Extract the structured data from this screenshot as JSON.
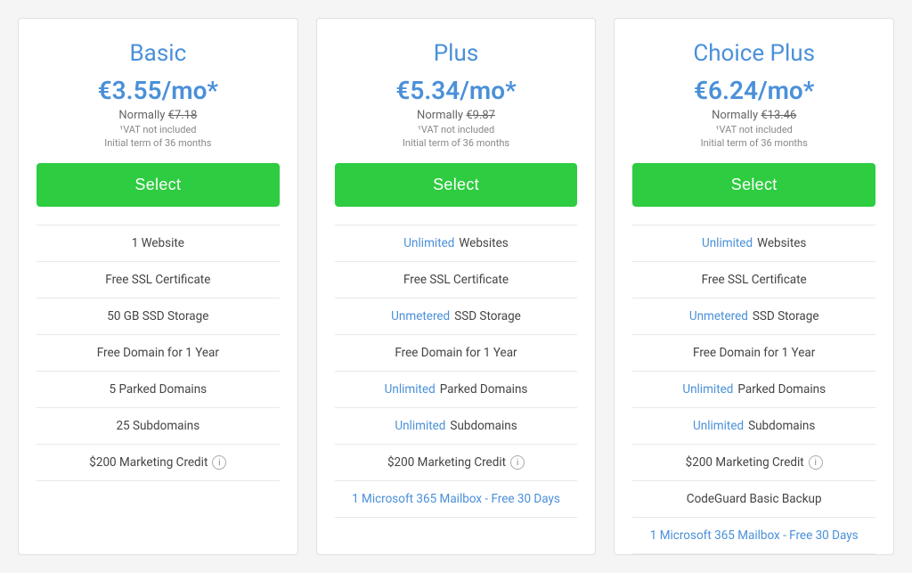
{
  "plans": [
    {
      "id": "basic",
      "title": "Basic",
      "price": "€3.55/mo*",
      "normal_price_label": "Normally",
      "normal_price": "€7.18",
      "vat": "¹VAT not included",
      "term": "Initial term of 36 months",
      "select_label": "Select",
      "features": [
        {
          "text": "1 Website",
          "highlight": false,
          "highlight_word": null,
          "is_link": false,
          "has_info": false
        },
        {
          "text": "Free SSL Certificate",
          "highlight": false,
          "highlight_word": null,
          "is_link": false,
          "has_info": false
        },
        {
          "text": "50 GB SSD Storage",
          "highlight": false,
          "highlight_word": null,
          "is_link": false,
          "has_info": false
        },
        {
          "text": "Free Domain for 1 Year",
          "highlight": false,
          "highlight_word": null,
          "is_link": false,
          "has_info": false
        },
        {
          "text": "5 Parked Domains",
          "highlight": false,
          "highlight_word": null,
          "is_link": false,
          "has_info": false
        },
        {
          "text": "25 Subdomains",
          "highlight": false,
          "highlight_word": null,
          "is_link": false,
          "has_info": false
        },
        {
          "text": "$200 Marketing Credit",
          "highlight": false,
          "highlight_word": null,
          "is_link": false,
          "has_info": true
        }
      ]
    },
    {
      "id": "plus",
      "title": "Plus",
      "price": "€5.34/mo*",
      "normal_price_label": "Normally",
      "normal_price": "€9.87",
      "vat": "¹VAT not included",
      "term": "Initial term of 36 months",
      "select_label": "Select",
      "features": [
        {
          "text": "Websites",
          "highlight": true,
          "highlight_word": "Unlimited",
          "is_link": false,
          "has_info": false
        },
        {
          "text": "Free SSL Certificate",
          "highlight": false,
          "highlight_word": null,
          "is_link": false,
          "has_info": false
        },
        {
          "text": "SSD Storage",
          "highlight": true,
          "highlight_word": "Unmetered",
          "is_link": false,
          "has_info": false
        },
        {
          "text": "Free Domain for 1 Year",
          "highlight": false,
          "highlight_word": null,
          "is_link": false,
          "has_info": false
        },
        {
          "text": "Parked Domains",
          "highlight": true,
          "highlight_word": "Unlimited",
          "is_link": false,
          "has_info": false
        },
        {
          "text": "Subdomains",
          "highlight": true,
          "highlight_word": "Unlimited",
          "is_link": false,
          "has_info": false
        },
        {
          "text": "$200 Marketing Credit",
          "highlight": false,
          "highlight_word": null,
          "is_link": false,
          "has_info": true
        },
        {
          "text": "1 Microsoft 365 Mailbox - Free 30 Days",
          "highlight": false,
          "highlight_word": null,
          "is_link": true,
          "has_info": false
        }
      ]
    },
    {
      "id": "choice-plus",
      "title": "Choice Plus",
      "price": "€6.24/mo*",
      "normal_price_label": "Normally",
      "normal_price": "€13.46",
      "vat": "¹VAT not included",
      "term": "Initial term of 36 months",
      "select_label": "Select",
      "features": [
        {
          "text": "Websites",
          "highlight": true,
          "highlight_word": "Unlimited",
          "is_link": false,
          "has_info": false
        },
        {
          "text": "Free SSL Certificate",
          "highlight": false,
          "highlight_word": null,
          "is_link": false,
          "has_info": false
        },
        {
          "text": "SSD Storage",
          "highlight": true,
          "highlight_word": "Unmetered",
          "is_link": false,
          "has_info": false
        },
        {
          "text": "Free Domain for 1 Year",
          "highlight": false,
          "highlight_word": null,
          "is_link": false,
          "has_info": false
        },
        {
          "text": "Parked Domains",
          "highlight": true,
          "highlight_word": "Unlimited",
          "is_link": false,
          "has_info": false
        },
        {
          "text": "Subdomains",
          "highlight": true,
          "highlight_word": "Unlimited",
          "is_link": false,
          "has_info": false
        },
        {
          "text": "$200 Marketing Credit",
          "highlight": false,
          "highlight_word": null,
          "is_link": false,
          "has_info": true
        },
        {
          "text": "CodeGuard Basic Backup",
          "highlight": false,
          "highlight_word": null,
          "is_link": false,
          "has_info": false
        },
        {
          "text": "1 Microsoft 365 Mailbox - Free 30 Days",
          "highlight": false,
          "highlight_word": null,
          "is_link": true,
          "has_info": false
        }
      ]
    }
  ]
}
